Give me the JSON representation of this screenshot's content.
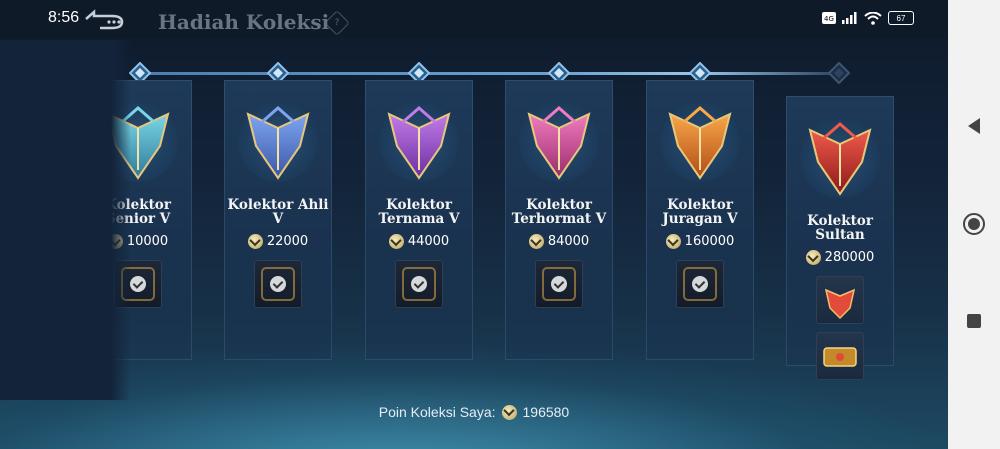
{
  "status": {
    "time": "8:56",
    "battery": "67"
  },
  "header": {
    "title": "Hadiah Koleksi",
    "help_icon": "?"
  },
  "tiers": [
    {
      "name_line1": "Kolektor",
      "name_line2": "Senior V",
      "points": "10000",
      "claimed": true,
      "colors": [
        "#7ad6e6",
        "#2f7a9a"
      ]
    },
    {
      "name_line1": "Kolektor Ahli",
      "name_line2": "V",
      "points": "22000",
      "claimed": true,
      "colors": [
        "#7ea6f0",
        "#3a56a8"
      ]
    },
    {
      "name_line1": "Kolektor",
      "name_line2": "Ternama V",
      "points": "44000",
      "claimed": true,
      "colors": [
        "#c27be8",
        "#6a2ea2"
      ]
    },
    {
      "name_line1": "Kolektor",
      "name_line2": "Terhormat V",
      "points": "84000",
      "claimed": true,
      "colors": [
        "#f07cc0",
        "#9a2a6a"
      ]
    },
    {
      "name_line1": "Kolektor",
      "name_line2": "Juragan V",
      "points": "160000",
      "claimed": true,
      "colors": [
        "#f7a84a",
        "#b24a14"
      ]
    },
    {
      "name_line1": "Kolektor",
      "name_line2": "Sultan",
      "points": "280000",
      "claimed": false,
      "colors": [
        "#f05a4a",
        "#8a1a1a"
      ]
    }
  ],
  "footer": {
    "label": "Poin Koleksi Saya:",
    "value": "196580"
  },
  "navbar": {
    "back_icon": "triangle-back-icon",
    "home_icon": "circle-home-icon",
    "recents_icon": "square-recents-icon"
  }
}
